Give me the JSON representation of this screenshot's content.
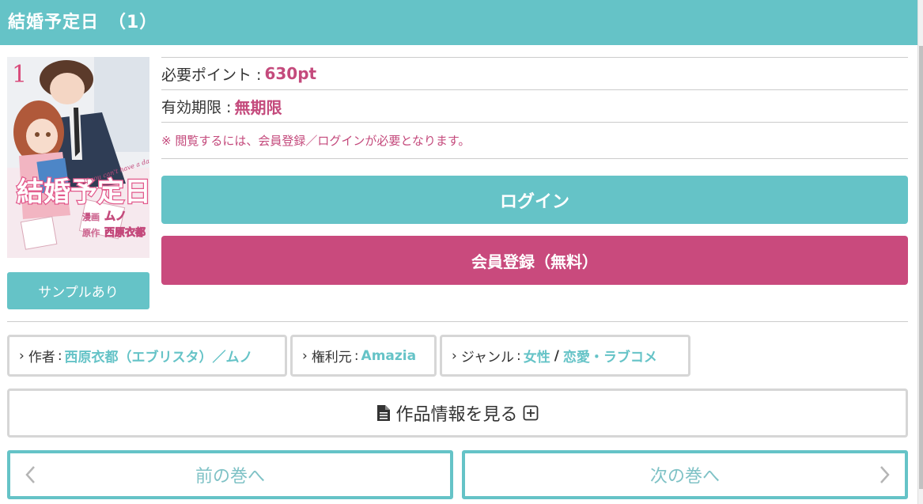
{
  "header": {
    "title": "結婚予定日　（1）"
  },
  "cover": {
    "volume_number": "1",
    "title_logo": "結婚予定日",
    "english_tagline": "If you can't have a dance,",
    "artist_label": "漫画",
    "artist_name": "ムノ",
    "author_label": "原作",
    "author_name": "西原衣都"
  },
  "sample_button": {
    "label": "サンプルあり"
  },
  "info": {
    "points_label": "必要ポイント :",
    "points_value": "630pt",
    "expiry_label": "有効期限 :",
    "expiry_value": "無期限",
    "notice": "※ 閲覧するには、会員登録／ログインが必要となります。"
  },
  "buttons": {
    "login": "ログイン",
    "register": "会員登録（無料）",
    "work_info": "作品情報を見る"
  },
  "tags": {
    "author_label": "作者",
    "author_value": "西原衣都（エブリスタ）／ムノ",
    "rights_label": "権利元",
    "rights_value": "Amazia",
    "genre_label": "ジャンル",
    "genre_value_1": "女性",
    "genre_slash": "/",
    "genre_value_2": "恋愛・ラブコメ",
    "colon": ":"
  },
  "nav": {
    "prev": "前の巻へ",
    "next": "次の巻へ"
  },
  "colors": {
    "teal": "#65c3c7",
    "pink": "#c94a7d",
    "border_gray": "#d6d6d6"
  }
}
